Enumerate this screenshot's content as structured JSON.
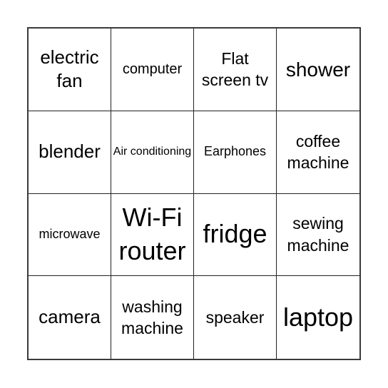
{
  "card": {
    "cells": [
      {
        "text": "electric fan",
        "size": "s-ml"
      },
      {
        "text": "computer",
        "size": "s-sm"
      },
      {
        "text": "Flat screen tv",
        "size": "s-m"
      },
      {
        "text": "shower",
        "size": "s-l"
      },
      {
        "text": "blender",
        "size": "s-ml"
      },
      {
        "text": "Air conditioning",
        "size": "s-xs"
      },
      {
        "text": "Earphones",
        "size": "s-s"
      },
      {
        "text": "coffee machine",
        "size": "s-m"
      },
      {
        "text": "microwave",
        "size": "s-s"
      },
      {
        "text": "Wi-Fi router",
        "size": "s-xl"
      },
      {
        "text": "fridge",
        "size": "s-xl"
      },
      {
        "text": "sewing machine",
        "size": "s-m"
      },
      {
        "text": "camera",
        "size": "s-ml"
      },
      {
        "text": "washing machine",
        "size": "s-m"
      },
      {
        "text": "speaker",
        "size": "s-m"
      },
      {
        "text": "laptop",
        "size": "s-xl"
      }
    ]
  }
}
